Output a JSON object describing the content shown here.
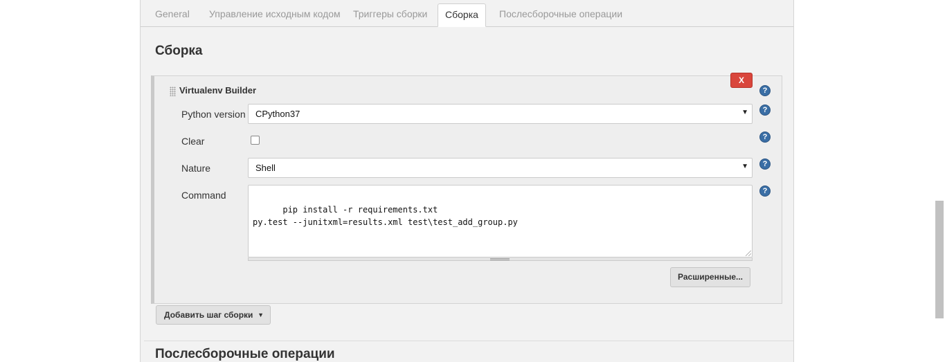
{
  "tabs": [
    {
      "label": "General"
    },
    {
      "label": "Управление исходным кодом"
    },
    {
      "label": "Триггеры сборки"
    },
    {
      "label": "Сборка",
      "active": true
    },
    {
      "label": "Послесборочные операции"
    }
  ],
  "build_section": {
    "title": "Сборка",
    "builder": {
      "title": "Virtualenv Builder",
      "delete_label": "X",
      "fields": {
        "python_version": {
          "label": "Python version",
          "value": "CPython37"
        },
        "clear": {
          "label": "Clear",
          "checked": false
        },
        "nature": {
          "label": "Nature",
          "value": "Shell"
        },
        "command": {
          "label": "Command",
          "value": "pip install -r requirements.txt\npy.test --junitxml=results.xml test\\test_add_group.py"
        }
      },
      "advanced_label": "Расширенные..."
    },
    "add_step_label": "Добавить шаг сборки"
  },
  "post_build_section": {
    "title": "Послесборочные операции"
  },
  "icons": {
    "help": "help-icon",
    "dropdown": "caret-down-icon",
    "drag": "drag-handle-icon"
  },
  "colors": {
    "delete_button": "#d9463c",
    "help_icon": "#3a6ea5",
    "panel_background": "#f2f2f2"
  }
}
